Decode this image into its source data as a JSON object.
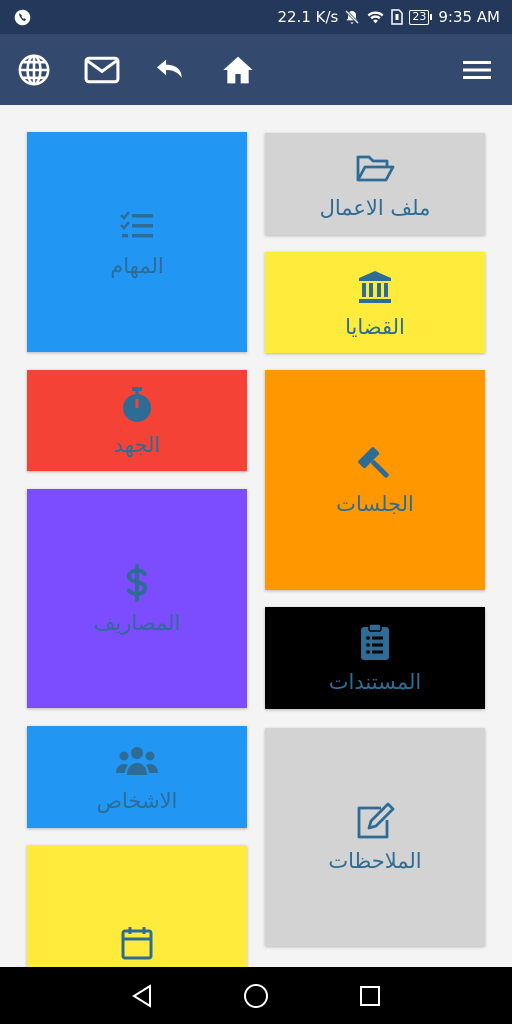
{
  "status_bar": {
    "speed": "22.1 K/s",
    "battery": "23",
    "time": "9:35 AM",
    "icons": [
      "phone-icon",
      "mute-icon",
      "wifi-icon",
      "sim-icon",
      "battery-icon"
    ]
  },
  "app_bar": {
    "icons": [
      "globe-icon",
      "mail-icon",
      "undo-icon",
      "home-icon",
      "menu-icon"
    ]
  },
  "tiles": {
    "files": {
      "label": "ملف الاعمال",
      "icon": "folder-open-icon",
      "color": "#d3d3d3"
    },
    "cases": {
      "label": "القضايا",
      "icon": "bank-icon",
      "color": "#ffeb3b"
    },
    "sessions": {
      "label": "الجلسات",
      "icon": "gavel-icon",
      "color": "#ff9800"
    },
    "documents": {
      "label": "المستندات",
      "icon": "clipboard-list-icon",
      "color": "#000000"
    },
    "notes": {
      "label": "الملاحظات",
      "icon": "edit-icon",
      "color": "#d3d3d3"
    },
    "tasks": {
      "label": "المهام",
      "icon": "tasks-icon",
      "color": "#2196f3"
    },
    "effort": {
      "label": "الجهد",
      "icon": "stopwatch-icon",
      "color": "#f44336"
    },
    "expenses": {
      "label": "المصاريف",
      "icon": "dollar-icon",
      "color": "#7c4dff"
    },
    "persons": {
      "label": "الاشخاص",
      "icon": "users-icon",
      "color": "#2196f3"
    },
    "calendar": {
      "label": "",
      "icon": "calendar-icon",
      "color": "#ffeb3b"
    }
  },
  "accent_color": "#2e6c96",
  "nav_bar": {
    "icons": [
      "back-icon",
      "home-circle-icon",
      "recents-icon"
    ]
  }
}
